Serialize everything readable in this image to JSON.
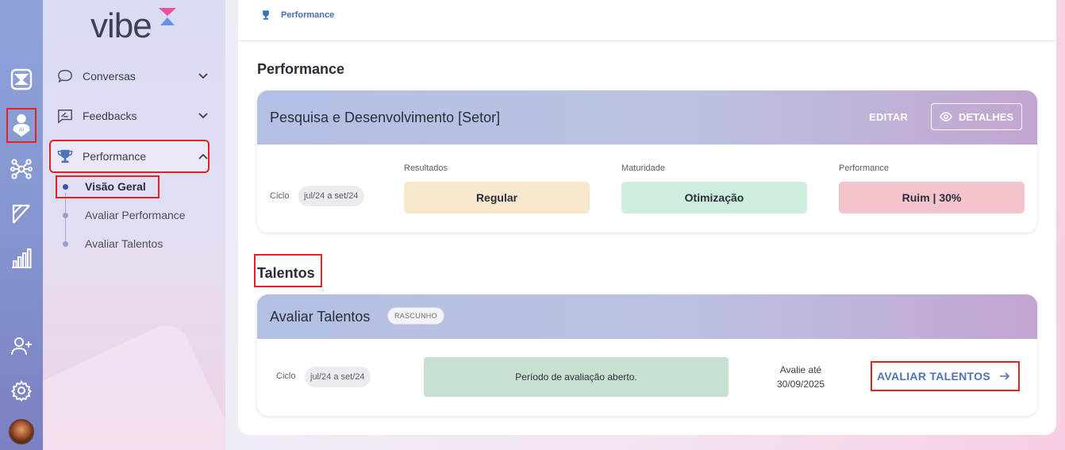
{
  "app": {
    "logo": "vibe"
  },
  "rail": {
    "icons": [
      {
        "name": "inbox-icon"
      },
      {
        "name": "ai-user-icon"
      },
      {
        "name": "network-icon"
      },
      {
        "name": "document-icon"
      },
      {
        "name": "bar-chart-icon"
      },
      {
        "name": "add-user-icon"
      },
      {
        "name": "settings-icon"
      },
      {
        "name": "avatar"
      }
    ]
  },
  "sidebar": {
    "items": [
      {
        "label": "Conversas",
        "icon": "chat-bubble-icon"
      },
      {
        "label": "Feedbacks",
        "icon": "feedback-icon"
      },
      {
        "label": "Performance",
        "icon": "trophy-icon"
      }
    ],
    "sub_items": [
      {
        "label": "Visão Geral",
        "active": true
      },
      {
        "label": "Avaliar Performance",
        "active": false
      },
      {
        "label": "Avaliar Talentos",
        "active": false
      }
    ]
  },
  "breadcrumb": {
    "label": "Performance"
  },
  "performance": {
    "section_title": "Performance",
    "card_title": "Pesquisa e Desenvolvimento [Setor]",
    "edit_label": "EDITAR",
    "details_label": "DETALHES",
    "cycle_label": "Ciclo",
    "cycle_value": "jul/24 a set/24",
    "metrics": [
      {
        "label": "Resultados",
        "value": "Regular",
        "color": "#f7e8cc"
      },
      {
        "label": "Maturidade",
        "value": "Otimização",
        "color": "#cdeedd"
      },
      {
        "label": "Performance",
        "value": "Ruim | 30%",
        "color": "#f3c4cc"
      }
    ]
  },
  "talentos": {
    "section_title": "Talentos",
    "card_title": "Avaliar Talentos",
    "badge": "RASCUNHO",
    "cycle_label": "Ciclo",
    "cycle_value": "jul/24 a set/24",
    "period_status": "Período de avaliação aberto.",
    "deadline_label": "Avalie até",
    "deadline_date": "30/09/2025",
    "action_label": "AVALIAR TALENTOS"
  },
  "colors": {
    "accent": "#4e73b8",
    "highlight": "#e02424"
  }
}
